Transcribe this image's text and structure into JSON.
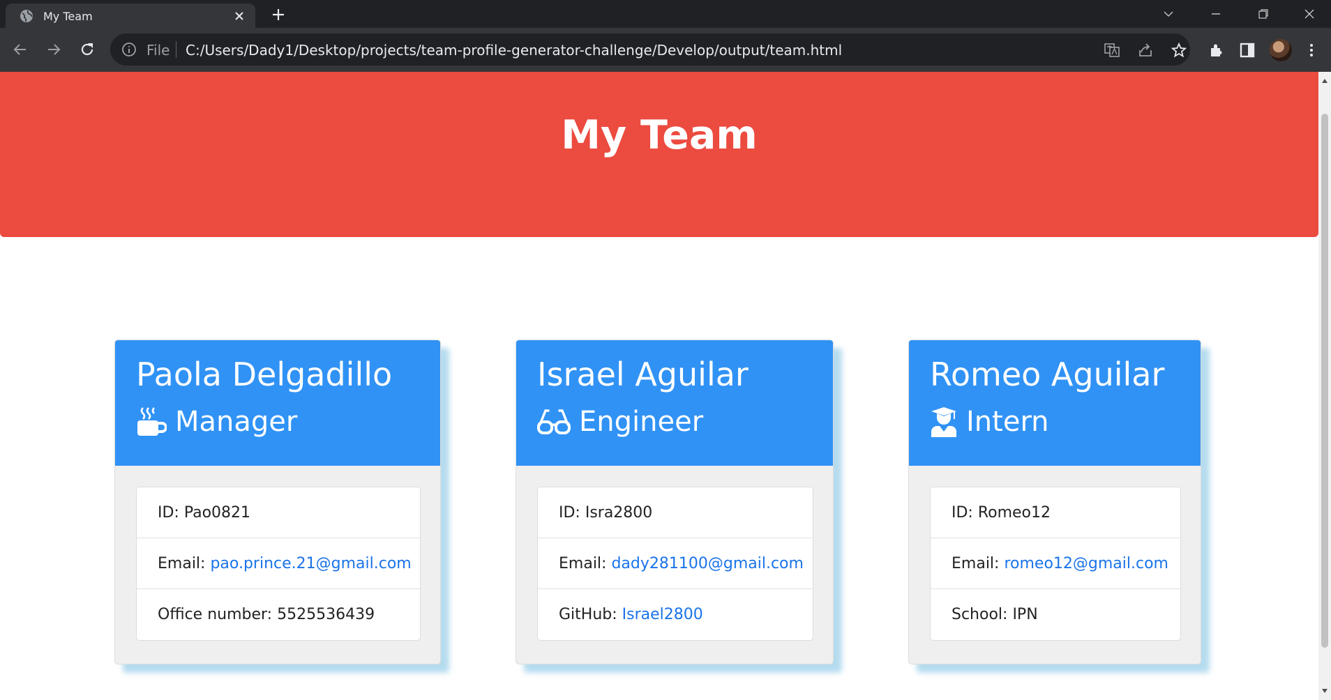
{
  "browser": {
    "tab_title": "My Team",
    "omnibox_scheme": "File",
    "url": "C:/Users/Dady1/Desktop/projects/team-profile-generator-challenge/Develop/output/team.html"
  },
  "page": {
    "heading": "My Team",
    "employees": [
      {
        "name": "Paola Delgadillo",
        "role": "Manager",
        "role_icon": "mug-icon",
        "id_label": "ID: Pao0821",
        "email_label": "Email:",
        "email": "pao.prince.21@gmail.com",
        "extra_label": "Office number: 5525536439",
        "extra_link": ""
      },
      {
        "name": "Israel Aguilar",
        "role": "Engineer",
        "role_icon": "glasses-icon",
        "id_label": "ID: Isra2800",
        "email_label": "Email:",
        "email": "dady281100@gmail.com",
        "extra_label": "GitHub:",
        "extra_link": "Israel2800"
      },
      {
        "name": "Romeo Aguilar",
        "role": "Intern",
        "role_icon": "graduate-icon",
        "id_label": "ID: Romeo12",
        "email_label": "Email:",
        "email": "romeo12@gmail.com",
        "extra_label": "School: IPN",
        "extra_link": ""
      }
    ]
  },
  "colors": {
    "jumbotron": "#ec4b40",
    "card_header": "#3092f5",
    "link": "#1a73e8"
  }
}
